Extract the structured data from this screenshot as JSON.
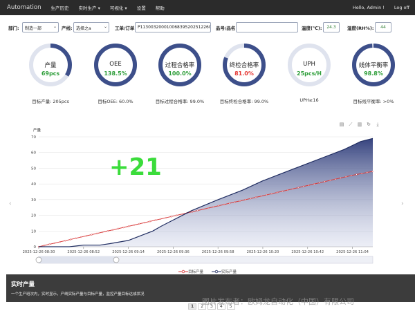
{
  "navbar": {
    "brand": "Automation",
    "items": [
      "生产历史",
      "实时生产 ▾",
      "可视化 ▾",
      "设置",
      "帮助"
    ],
    "greeting": "Hello, Admin !",
    "logout": "Log off"
  },
  "filters": {
    "dept_label": "部门:",
    "dept_value": "制造一部",
    "line_label": "产线:",
    "line_value": "选择之a",
    "order_label": "工单/订单:",
    "order_value": "P113003200010068395202512260",
    "part_label": "品号/品名:",
    "part_value": "",
    "temp_label": "温度(℃):",
    "temp_value": "24.3",
    "humidity_label": "湿度(RH%):",
    "humidity_value": "44"
  },
  "kpis": [
    {
      "title": "产量",
      "value": "69pcs",
      "target": "目标产量: 205pcs",
      "fraction": 0.34,
      "value_color": "#2e9e3a"
    },
    {
      "title": "OEE",
      "value": "138.5%",
      "target": "目标OEE: 60.0%",
      "fraction": 1.0,
      "value_color": "#2e9e3a"
    },
    {
      "title": "过程合格率",
      "value": "100.0%",
      "target": "目标过程合格率: 99.0%",
      "fraction": 1.0,
      "value_color": "#2e9e3a"
    },
    {
      "title": "终检合格率",
      "value": "81.0%",
      "target": "目标终检合格率: 99.0%",
      "fraction": 0.81,
      "value_color": "#e53935"
    },
    {
      "title": "UPH",
      "value": "25pcs/H",
      "target": "UPH≥16",
      "fraction": 0.0,
      "value_color": "#2e9e3a"
    },
    {
      "title": "线体平衡率",
      "value": "98.8%",
      "target": "目标线平衡率: >0%",
      "fraction": 0.988,
      "value_color": "#2e9e3a"
    }
  ],
  "colors": {
    "gauge_fill": "#3d4f8a",
    "gauge_track": "#dfe3ee",
    "actual_line": "#1f2c60",
    "target_line": "#d93a3a",
    "delta": "#3bdc3b"
  },
  "icons": [
    "save-icon",
    "line-chart-icon",
    "bar-chart-icon",
    "refresh-icon",
    "download-icon"
  ],
  "delta": "+21",
  "chart_data": {
    "type": "line",
    "ylabel": "产量",
    "ylim": [
      0,
      70
    ],
    "yticks": [
      0,
      10,
      20,
      30,
      40,
      50,
      60,
      70
    ],
    "xtick_labels": [
      "2025-12-26 08:30",
      "2025-12-26 08:52",
      "2025-12-26 09:14",
      "2025-12-26 09:36",
      "2025-12-26 09:58",
      "2025-12-26 10:20",
      "2025-12-26 10:42",
      "2025-12-26 11:04"
    ],
    "series": [
      {
        "name": "目标产量",
        "x": [
          0,
          22,
          44,
          66,
          88,
          110,
          132,
          154,
          164
        ],
        "values": [
          0,
          6.5,
          13,
          19.5,
          26,
          32.5,
          39,
          45.5,
          48
        ]
      },
      {
        "name": "实际产量",
        "x": [
          0,
          15,
          22,
          30,
          35,
          44,
          50,
          56,
          60,
          66,
          75,
          88,
          100,
          110,
          120,
          132,
          140,
          150,
          158,
          164
        ],
        "values": [
          0,
          0,
          1,
          1,
          2,
          4,
          7,
          10,
          13,
          17,
          23,
          30,
          36,
          42,
          47,
          53,
          57,
          62,
          67,
          69
        ]
      }
    ]
  },
  "bottom": {
    "title": "实时产量",
    "desc": "一个生产班次内，实时显示，产线实际产量与目标产量，监控产量目标达成状况"
  },
  "pager": [
    "1",
    "2",
    "3",
    "4",
    "5"
  ],
  "watermark": "图片发布者：欧姆龙自动化（中国）有限公司"
}
